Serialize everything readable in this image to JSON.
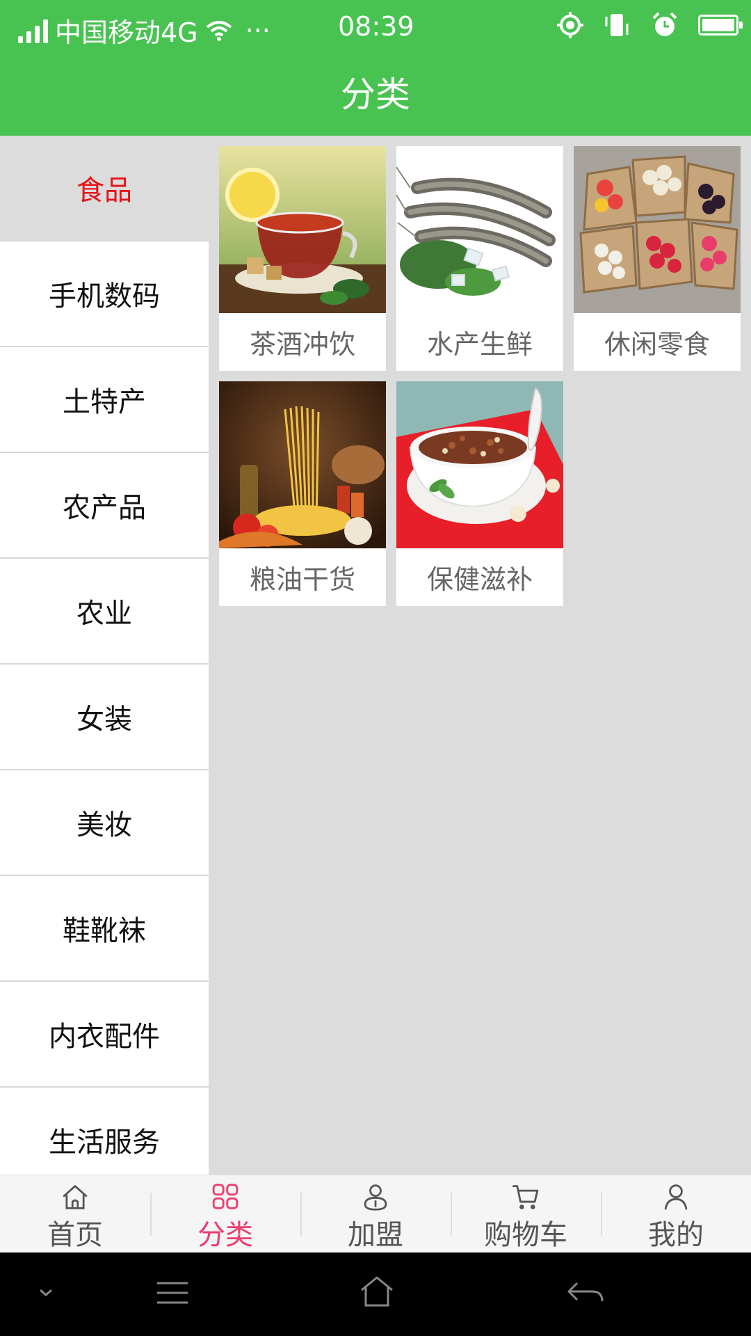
{
  "status_bar": {
    "carrier": "中国移动4G",
    "more": "···",
    "time": "08:39"
  },
  "header": {
    "title": "分类"
  },
  "sidebar": {
    "items": [
      {
        "label": "食品",
        "active": true
      },
      {
        "label": "手机数码"
      },
      {
        "label": "土特产"
      },
      {
        "label": "农产品"
      },
      {
        "label": "农业"
      },
      {
        "label": "女装"
      },
      {
        "label": "美妆"
      },
      {
        "label": "鞋靴袜"
      },
      {
        "label": "内衣配件"
      },
      {
        "label": "生活服务"
      }
    ]
  },
  "categories": [
    {
      "label": "茶酒冲饮",
      "image": "tea-image"
    },
    {
      "label": "水产生鲜",
      "image": "shrimp-image"
    },
    {
      "label": "休闲零食",
      "image": "snacks-image"
    },
    {
      "label": "粮油干货",
      "image": "pasta-image"
    },
    {
      "label": "保健滋补",
      "image": "porridge-image"
    }
  ],
  "tabbar": {
    "items": [
      {
        "label": "首页",
        "icon": "home-icon"
      },
      {
        "label": "分类",
        "icon": "category-icon",
        "active": true
      },
      {
        "label": "加盟",
        "icon": "join-icon"
      },
      {
        "label": "购物车",
        "icon": "cart-icon"
      },
      {
        "label": "我的",
        "icon": "profile-icon"
      }
    ]
  },
  "colors": {
    "header_green": "#48c351",
    "active_red": "#e8141a",
    "tab_active_pink": "#ee3b6e"
  }
}
